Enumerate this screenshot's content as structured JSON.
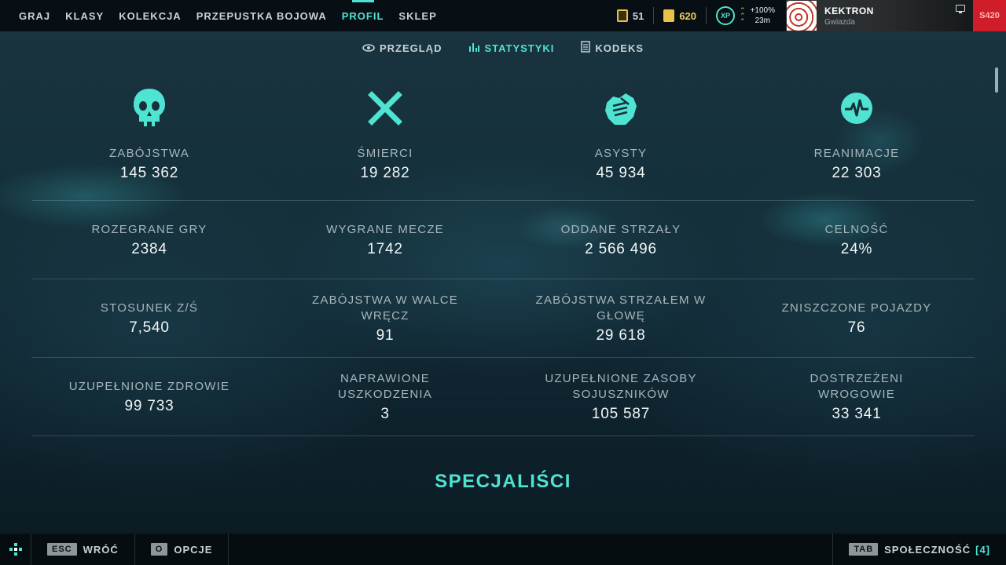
{
  "nav": {
    "items": [
      {
        "label": "GRAJ",
        "active": false
      },
      {
        "label": "KLASY",
        "active": false
      },
      {
        "label": "KOLEKCJA",
        "active": false
      },
      {
        "label": "PRZEPUSTKA BOJOWA",
        "active": false
      },
      {
        "label": "PROFIL",
        "active": true
      },
      {
        "label": "SKLEP",
        "active": false
      }
    ]
  },
  "header": {
    "coins": "51",
    "credits": "620",
    "xp_label": "XP",
    "boost_pct": "+100%",
    "boost_time": "23m",
    "player_name": "KEKTRON",
    "player_rank": "Gwiazda",
    "season_badge": "S420"
  },
  "subtabs": [
    {
      "label": "PRZEGLĄD",
      "icon": "eye-icon",
      "active": false
    },
    {
      "label": "STATYSTYKI",
      "icon": "bar-chart-icon",
      "active": true
    },
    {
      "label": "KODEKS",
      "icon": "document-icon",
      "active": false
    }
  ],
  "stats": {
    "row0": [
      {
        "label": "ZABÓJSTWA",
        "value": "145 362",
        "icon": "skull-icon"
      },
      {
        "label": "ŚMIERCI",
        "value": "19 282",
        "icon": "cross-icon"
      },
      {
        "label": "ASYSTY",
        "value": "45 934",
        "icon": "handshake-icon"
      },
      {
        "label": "REANIMACJE",
        "value": "22 303",
        "icon": "heartbeat-icon"
      }
    ],
    "row1": [
      {
        "label": "ROZEGRANE GRY",
        "value": "2384"
      },
      {
        "label": "WYGRANE MECZE",
        "value": "1742"
      },
      {
        "label": "ODDANE STRZAŁY",
        "value": "2 566 496"
      },
      {
        "label": "CELNOŚĆ",
        "value": "24%"
      }
    ],
    "row2": [
      {
        "label": "STOSUNEK Z/Ś",
        "value": "7,540"
      },
      {
        "label": "ZABÓJSTWA W WALCE WRĘCZ",
        "value": "91"
      },
      {
        "label": "ZABÓJSTWA STRZAŁEM W GŁOWĘ",
        "value": "29 618"
      },
      {
        "label": "ZNISZCZONE POJAZDY",
        "value": "76"
      }
    ],
    "row3": [
      {
        "label": "UZUPEŁNIONE ZDROWIE",
        "value": "99 733"
      },
      {
        "label": "NAPRAWIONE USZKODZENIA",
        "value": "3"
      },
      {
        "label": "UZUPEŁNIONE ZASOBY SOJUSZNIKÓW",
        "value": "105 587"
      },
      {
        "label": "DOSTRZEŻENI WROGOWIE",
        "value": "33 341"
      }
    ]
  },
  "section_title": "SPECJALIŚCI",
  "footer": {
    "back_key": "ESC",
    "back_label": "WRÓĆ",
    "options_key": "O",
    "options_label": "OPCJE",
    "social_key": "TAB",
    "social_label": "SPOŁECZNOŚĆ",
    "social_count": "[4]"
  },
  "colors": {
    "accent": "#4fe3d2",
    "gold": "#e8c24a",
    "badge_red": "#d01d2a"
  }
}
